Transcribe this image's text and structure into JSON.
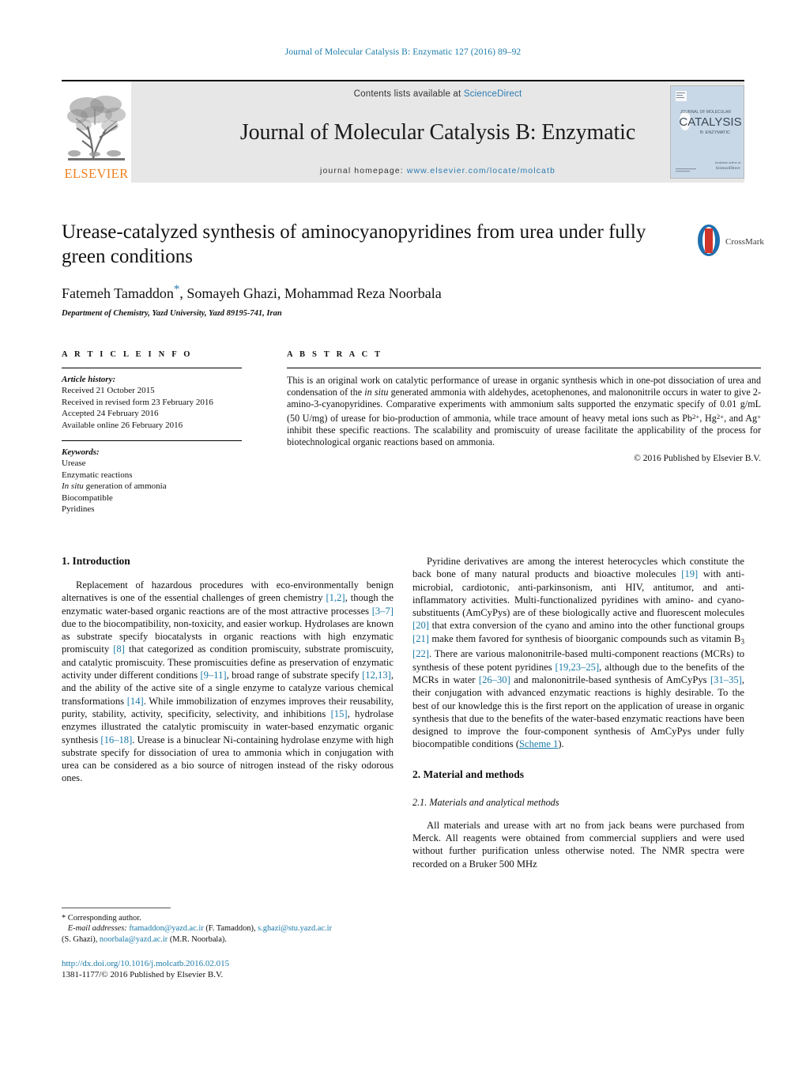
{
  "running_head": "Journal of Molecular Catalysis B: Enzymatic 127 (2016) 89–92",
  "masthead": {
    "publisher_name": "ELSEVIER",
    "contents_prefix": "Contents lists available at ",
    "contents_link": "ScienceDirect",
    "journal_title": "Journal of Molecular Catalysis B: Enzymatic",
    "homepage_label": "journal homepage:",
    "homepage_url": "www.elsevier.com/locate/molcatb",
    "cover_title_line1": "JOURNAL OF MOLECULAR",
    "cover_title_line2": "CATALYSIS",
    "cover_title_line3": "B: ENZYMATIC"
  },
  "article": {
    "title": "Urease-catalyzed synthesis of aminocyanopyridines from urea under fully green conditions",
    "authors": "Fatemeh Tamaddon",
    "authors_rest": ", Somayeh Ghazi, Mohammad Reza Noorbala",
    "corresponding_marker": "*",
    "affiliation": "Department of Chemistry, Yazd University, Yazd 89195-741, Iran",
    "crossmark_label": "CrossMark"
  },
  "article_info": {
    "heading": "A R T I C L E   I N F O",
    "history_label": "Article history:",
    "history": [
      "Received 21 October 2015",
      "Received in revised form 23 February 2016",
      "Accepted 24 February 2016",
      "Available online 26 February 2016"
    ],
    "keywords_label": "Keywords:",
    "keywords": [
      "Urease",
      "Enzymatic reactions",
      "In situ generation of ammonia",
      "Biocompatible",
      "Pyridines"
    ]
  },
  "abstract": {
    "heading": "A B S T R A C T",
    "copyright": "© 2016 Published by Elsevier B.V."
  },
  "sections": {
    "intro_heading": "1.  Introduction",
    "methods_heading": "2.  Material and methods",
    "methods_sub_heading": "2.1.  Materials and analytical methods"
  },
  "footnote": {
    "corresponding": "*  Corresponding author.",
    "email_label": "E-mail addresses:",
    "email1": "ftamaddon@yazd.ac.ir",
    "email1_owner": "(F. Tamaddon)",
    "email2": "s.ghazi@stu.yazd.ac.ir",
    "email2_owner": "(S. Ghazi)",
    "email3": "noorbala@yazd.ac.ir",
    "email3_owner": "(M.R. Noorbala)."
  },
  "doi": {
    "url": "http://dx.doi.org/10.1016/j.molcatb.2016.02.015",
    "issn_line": "1381-1177/© 2016 Published by Elsevier B.V."
  },
  "colors": {
    "link_blue": "#1a7aa8",
    "elsevier_orange": "#f08020",
    "banner_gray": "#e7e7e7",
    "cover_blue": "#c9d8e6"
  }
}
